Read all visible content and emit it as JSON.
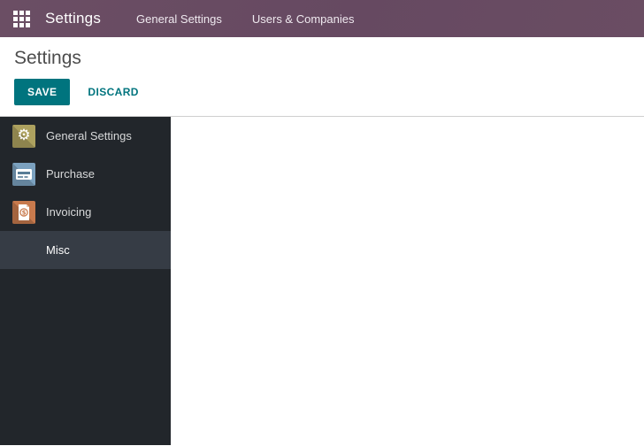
{
  "topbar": {
    "app_title": "Settings",
    "menu_items": [
      {
        "label": "General Settings"
      },
      {
        "label": "Users & Companies"
      }
    ]
  },
  "header": {
    "page_title": "Settings",
    "buttons": {
      "save": "SAVE",
      "discard": "DISCARD"
    }
  },
  "sidebar": {
    "items": [
      {
        "label": "General Settings",
        "icon": "gear-icon",
        "icon_bg": "#ada15f",
        "selected": false
      },
      {
        "label": "Purchase",
        "icon": "credit-card-icon",
        "icon_bg": "#7ba1bf",
        "selected": false
      },
      {
        "label": "Invoicing",
        "icon": "invoice-dollar-icon",
        "icon_bg": "#c87a4d",
        "selected": false
      },
      {
        "label": "Misc",
        "icon": null,
        "selected": true
      }
    ]
  },
  "main": {
    "content": ""
  },
  "colors": {
    "topbar_bg": "#694c62",
    "accent_teal": "#00747e",
    "sidebar_bg": "#22262b",
    "sidebar_selected_bg": "#363c45",
    "heading_text": "#4d4d4d",
    "icon_gear_bg": "#ada15f",
    "icon_card_bg": "#7ba1bf",
    "icon_invoice_bg": "#c87a4d"
  }
}
